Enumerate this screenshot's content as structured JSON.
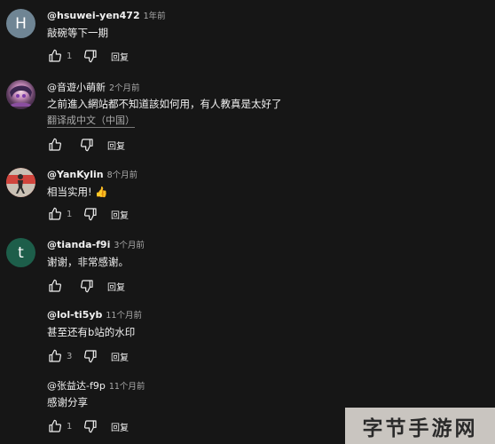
{
  "comments": [
    {
      "author": "@hsuwei-yen472",
      "time": "1年前",
      "text": "敲碗等下一期",
      "likes": "1",
      "reply_label": "回复",
      "avatar_letter": "H",
      "avatar_color": "#6f8594"
    },
    {
      "author": "@音遊小萌新",
      "time": "2个月前",
      "text": "之前進入網站都不知道該如何用，有人教真是太好了",
      "translate_label": "翻译成中文（中国）",
      "likes": "",
      "reply_label": "回复",
      "avatar_letter": "",
      "avatar_color": "#5a3a5c"
    },
    {
      "author": "@YanKylin",
      "time": "8个月前",
      "text": "相当实用! 👍",
      "likes": "1",
      "reply_label": "回复",
      "avatar_letter": "",
      "avatar_color": "#d0443c"
    },
    {
      "author": "@tianda-f9i",
      "time": "3个月前",
      "text": "谢谢，非常感谢。",
      "likes": "",
      "reply_label": "回复",
      "avatar_letter": "t",
      "avatar_color": "#1d5e4a"
    },
    {
      "author": "@lol-ti5yb",
      "time": "11个月前",
      "text": "甚至还有b站的水印",
      "likes": "3",
      "reply_label": "回复",
      "avatar_letter": "",
      "avatar_color": ""
    },
    {
      "author": "@张益达-f9p",
      "time": "11个月前",
      "text": "感谢分享",
      "likes": "1",
      "reply_label": "回复",
      "avatar_letter": "",
      "avatar_color": ""
    }
  ],
  "watermark": {
    "text": "字节手游网"
  },
  "icons": {
    "like": "thumbs-up-icon",
    "dislike": "thumbs-down-icon"
  },
  "colors": {
    "background": "#161616",
    "text_primary": "#f1f1f1",
    "text_secondary": "#aaaaaa",
    "watermark_bg": "#c9c5c0"
  }
}
